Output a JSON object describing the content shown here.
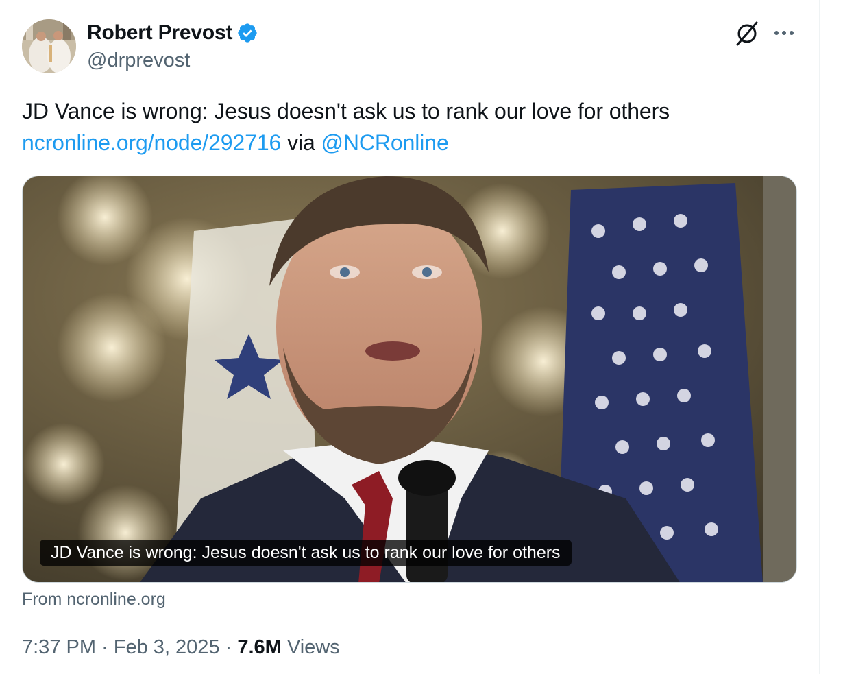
{
  "author": {
    "name": "Robert Prevost",
    "handle": "@drprevost",
    "verified": true
  },
  "tweet": {
    "text": "JD Vance is wrong: Jesus doesn't ask us to rank our love for others",
    "link": "ncronline.org/node/292716",
    "via": "via",
    "mention": "@NCRonline"
  },
  "card": {
    "caption": "JD Vance is wrong: Jesus doesn't ask us to rank our love for others",
    "source": "From ncronline.org"
  },
  "meta": {
    "time": "7:37 PM",
    "separator": " · ",
    "date": "Feb 3, 2025",
    "views_count": "7.6M",
    "views_label": " Views"
  },
  "icons": {
    "verified": "verified-badge-icon",
    "grok": "grok-icon",
    "more": "more-icon"
  },
  "colors": {
    "link": "#1d9bf0",
    "secondary_text": "#536471",
    "primary_text": "#0f1419",
    "verified_badge": "#1d9bf0"
  }
}
